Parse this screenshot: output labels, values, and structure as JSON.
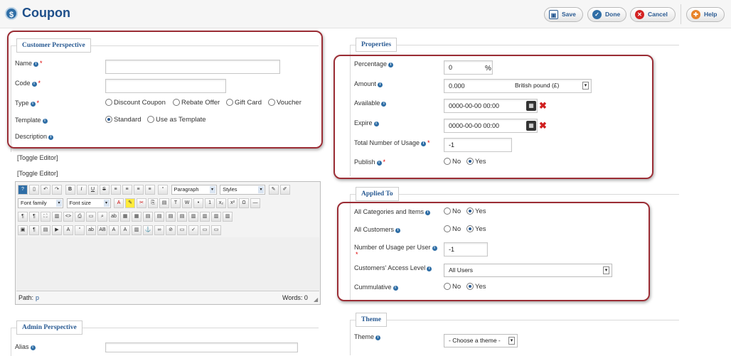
{
  "header": {
    "title": "Coupon",
    "logo_glyph": "$",
    "buttons": [
      {
        "label": "Save",
        "icon": "save-icon"
      },
      {
        "label": "Done",
        "icon": "check-icon"
      },
      {
        "label": "Cancel",
        "icon": "cancel-icon"
      },
      {
        "label": "Help",
        "icon": "help-icon"
      }
    ]
  },
  "customer_perspective": {
    "legend": "Customer Perspective",
    "name_label": "Name",
    "code_label": "Code",
    "type_label": "Type",
    "template_label": "Template",
    "description_label": "Description",
    "type_options": [
      "Discount Coupon",
      "Rebate Offer",
      "Gift Card",
      "Voucher"
    ],
    "template_options": [
      "Standard",
      "Use as Template"
    ],
    "template_selected": "Standard"
  },
  "editor": {
    "toggle1": "[Toggle Editor]",
    "toggle2": "[Toggle Editor]",
    "format_select": "Paragraph",
    "styles_select": "Styles",
    "font_family": "Font family",
    "font_size": "Font size",
    "path_label": "Path:",
    "path_value": "p",
    "words": "Words: 0"
  },
  "admin_perspective": {
    "legend": "Admin Perspective",
    "alias_label": "Alias"
  },
  "properties": {
    "legend": "Properties",
    "percentage_label": "Percentage",
    "percentage_value": "0",
    "percent_sign": "%",
    "amount_label": "Amount",
    "amount_value": "0.000",
    "currency": "British pound (£)",
    "available_label": "Available",
    "available_value": "0000-00-00 00:00",
    "expire_label": "Expire",
    "expire_value": "0000-00-00 00:00",
    "total_usage_label": "Total Number of Usage",
    "total_usage_value": "-1",
    "publish_label": "Publish",
    "publish_no": "No",
    "publish_yes": "Yes",
    "publish_selected": "Yes"
  },
  "applied_to": {
    "legend": "Applied To",
    "all_categories_label": "All Categories and Items",
    "all_customers_label": "All Customers",
    "usage_per_user_label": "Number of Usage per User",
    "usage_per_user_value": "-1",
    "access_level_label": "Customers' Access Level",
    "access_level_value": "All Users",
    "cummulative_label": "Cummulative",
    "no": "No",
    "yes": "Yes"
  },
  "theme": {
    "legend": "Theme",
    "theme_label": "Theme",
    "theme_value": "- Choose a theme -"
  },
  "colors": {
    "accent": "#2a5b93",
    "highlight": "#9b2d35",
    "required": "#dd0000"
  }
}
